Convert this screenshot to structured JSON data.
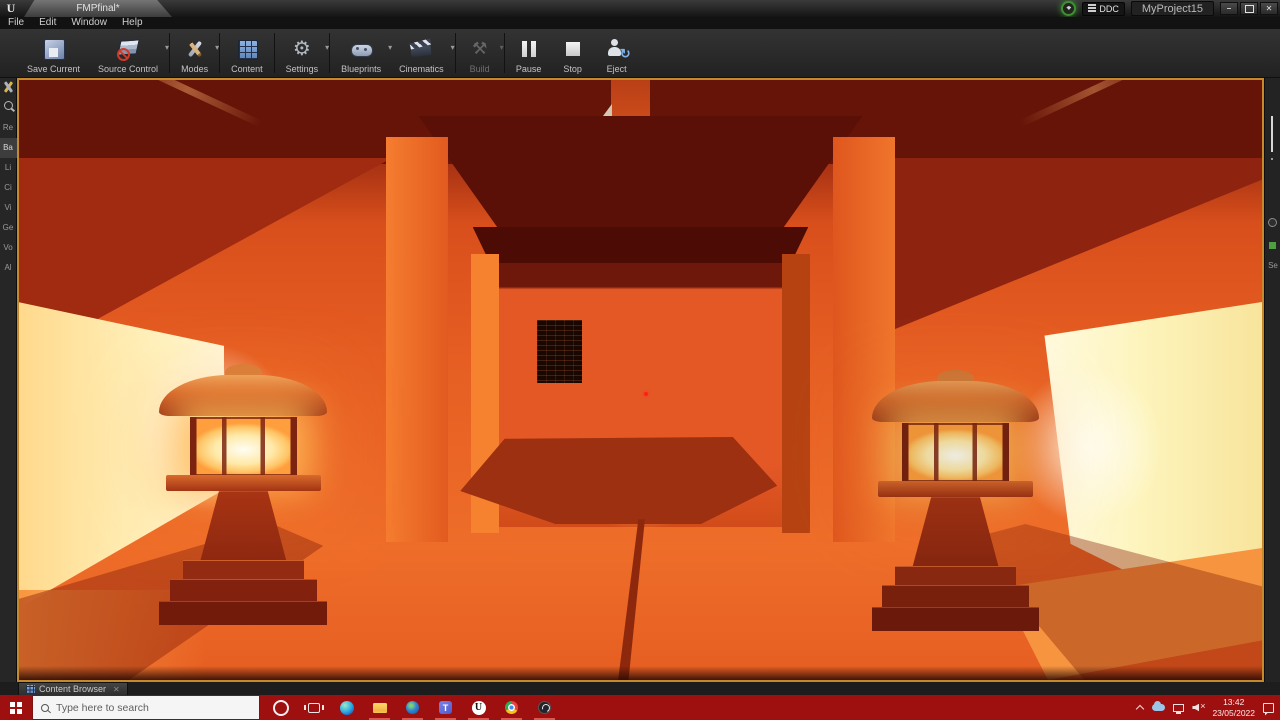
{
  "window": {
    "app": "Unreal Editor",
    "tab_title": "FMPfinal*",
    "menu": [
      "File",
      "Edit",
      "Window",
      "Help"
    ],
    "ddc_label": "DDC",
    "project_badge": "MyProject15",
    "title_icons": [
      "status-ring-icon",
      "ddc-icon"
    ],
    "controls": [
      "minimize",
      "maximize",
      "close"
    ]
  },
  "toolbar": {
    "buttons": [
      {
        "label": "Save Current",
        "icon": "floppy-icon",
        "dropdown": false,
        "disabled": false
      },
      {
        "label": "Source Control",
        "icon": "source-control-icon",
        "dropdown": true,
        "disabled": false
      },
      {
        "label": "Modes",
        "icon": "wrench-pencil-icon",
        "dropdown": true,
        "disabled": false
      },
      {
        "label": "Content",
        "icon": "content-grid-icon",
        "dropdown": false,
        "disabled": false
      },
      {
        "label": "Settings",
        "icon": "gear-icon",
        "dropdown": true,
        "disabled": false
      },
      {
        "label": "Blueprints",
        "icon": "gamepad-icon",
        "dropdown": true,
        "disabled": false
      },
      {
        "label": "Cinematics",
        "icon": "clapperboard-icon",
        "dropdown": true,
        "disabled": false
      },
      {
        "label": "Build",
        "icon": "hammer-icon",
        "dropdown": true,
        "disabled": true
      },
      {
        "label": "Pause",
        "icon": "pause-icon",
        "dropdown": false,
        "disabled": false
      },
      {
        "label": "Stop",
        "icon": "stop-icon",
        "dropdown": false,
        "disabled": false
      },
      {
        "label": "Eject",
        "icon": "eject-person-icon",
        "dropdown": false,
        "disabled": false
      }
    ],
    "gear_glyph": "⚙",
    "hammer_glyph": "⚒"
  },
  "place_panel": {
    "items": [
      "Re",
      "Ba",
      "Li",
      "Ci",
      "Vi",
      "Ge",
      "Vo",
      "Al"
    ],
    "active_index": 1,
    "icons": [
      "modes-tool-icon",
      "search-icon"
    ]
  },
  "right_panel": {
    "label": "Se"
  },
  "bottom_bar": {
    "tab_label": "Content Browser"
  },
  "taskbar": {
    "search_placeholder": "Type here to search",
    "accent_color": "#9e1010",
    "icons": [
      "start",
      "cortana",
      "task-view",
      "edge",
      "file-explorer",
      "globe-app",
      "teams",
      "unreal-engine",
      "chrome",
      "obs-studio"
    ],
    "running_apps": [
      "file-explorer",
      "globe-app",
      "teams",
      "unreal-engine",
      "chrome",
      "obs-studio"
    ],
    "teams_glyph": "T",
    "unreal_glyph": "U",
    "tray_icons": [
      "hidden-icons-caret",
      "onedrive-cloud",
      "network",
      "volume-muted",
      "action-center"
    ],
    "clock_time": "13:42",
    "clock_date": "23/05/2022"
  },
  "viewport": {
    "mode": "Play In Editor",
    "border_color": "#c5892b",
    "crosshair_color": "#ff2014",
    "scene": {
      "description": "Symmetrical Japanese-style interior lit in intense orange; central gate corridor leading to a back room with a dark slatted window; two glowing stone lanterns flanking the hall",
      "palette": {
        "ceiling_dark": "#671408",
        "wall_orange": "#e55d22",
        "light_pale_yellow": "#fdf4bc",
        "lantern_glow": "#fffef4",
        "floor_shadow": "#9c3010"
      }
    }
  }
}
